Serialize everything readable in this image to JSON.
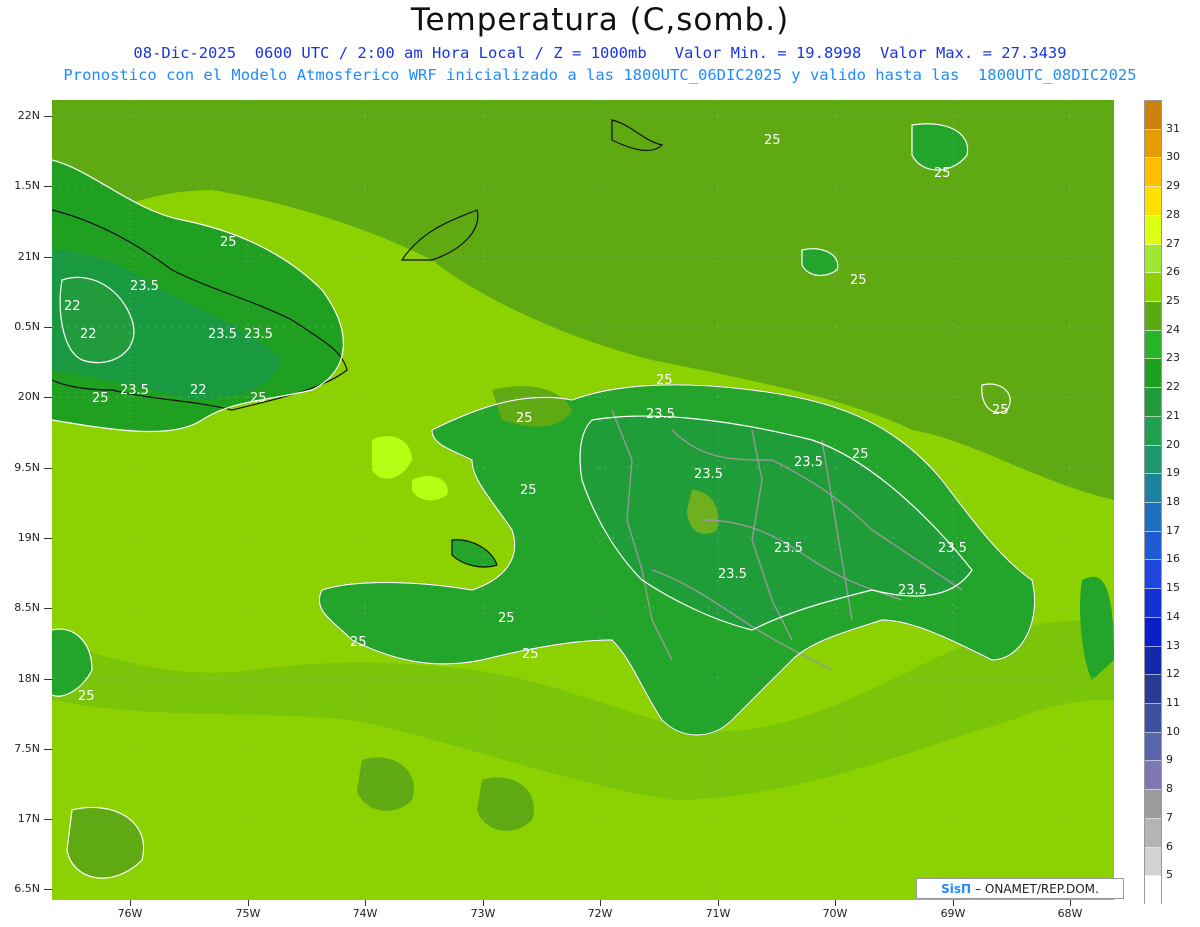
{
  "header": {
    "title": "Temperatura (C,somb.)",
    "subtitle_line1": "08-Dic-2025  0600 UTC / 2:00 am Hora Local / Z = 1000mb   Valor Min. = 19.8998  Valor Max. = 27.3439",
    "subtitle_line2": "Pronostico con el Modelo Atmosferico WRF inicializado a las 1800UTC_06DIC2025 y valido hasta las  1800UTC_08DIC2025"
  },
  "axes": {
    "lat_labels": [
      "22N",
      "1.5N",
      "21N",
      "0.5N",
      "20N",
      "9.5N",
      "19N",
      "8.5N",
      "18N",
      "7.5N",
      "17N",
      "6.5N"
    ],
    "lon_labels": [
      "76W",
      "75W",
      "74W",
      "73W",
      "72W",
      "71W",
      "70W",
      "69W",
      "68W"
    ]
  },
  "colorbar": {
    "labels": [
      "31",
      "30",
      "29",
      "28",
      "27",
      "26",
      "25",
      "24",
      "23",
      "22",
      "21",
      "20",
      "19",
      "18",
      "17",
      "16",
      "15",
      "14",
      "13",
      "12",
      "11",
      "10",
      "9",
      "8",
      "7",
      "6",
      "5"
    ],
    "colors": [
      "#c8820a",
      "#e69b00",
      "#ffbe00",
      "#ffe100",
      "#dcff14",
      "#a0e632",
      "#8cd200",
      "#5aaa14",
      "#28b428",
      "#1ea01e",
      "#229b3c",
      "#20a050",
      "#1e966e",
      "#1e82a0",
      "#1e6ebe",
      "#1e5ad2",
      "#1e46dc",
      "#1432d2",
      "#0a1ec8",
      "#1428aa",
      "#283c96",
      "#3c50a0",
      "#5a64aa",
      "#7d78b4",
      "#9b9b9b",
      "#b4b4b4",
      "#d2d2d2",
      "#ffffff"
    ]
  },
  "contour_labels": [
    "25",
    "25",
    "25",
    "25",
    "25",
    "23.5",
    "22",
    "22",
    "23.5",
    "23.5",
    "23.5",
    "22",
    "25",
    "25",
    "23.5",
    "25",
    "23.5",
    "23.5",
    "25",
    "23.5",
    "23.5",
    "25",
    "25",
    "25",
    "25",
    "25",
    "23.5",
    "23.5",
    "25"
  ],
  "credit": {
    "brand": "SisΠ",
    "text": "– ONAMET/REP.DOM."
  }
}
